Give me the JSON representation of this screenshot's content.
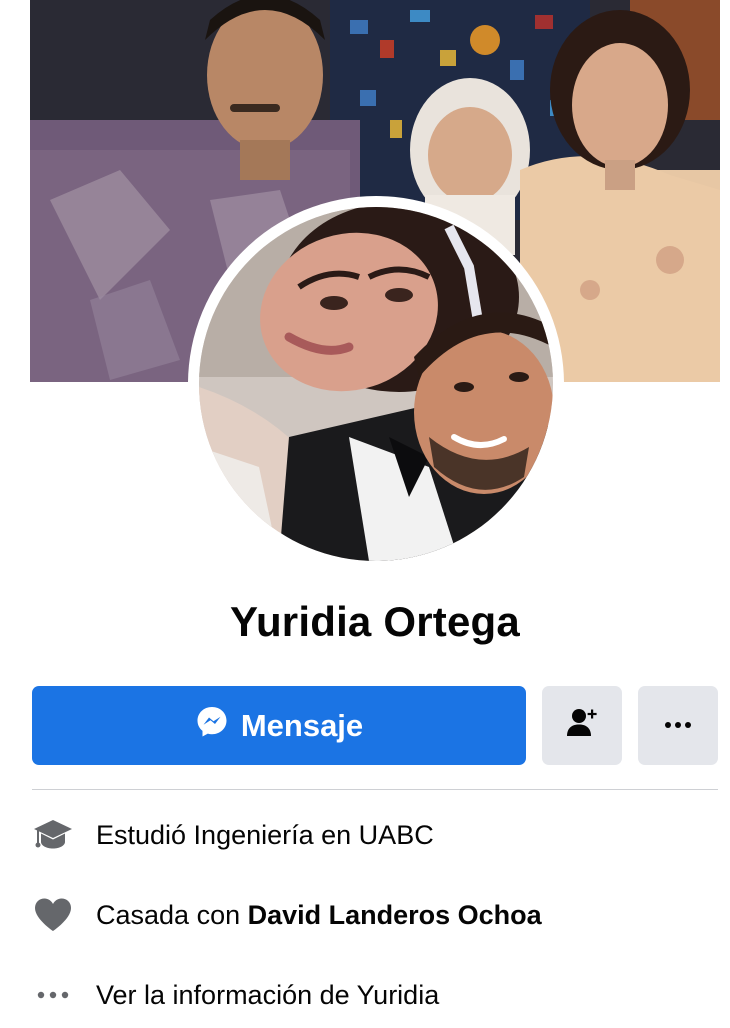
{
  "profile": {
    "name": "Yuridia Ortega"
  },
  "actions": {
    "message_label": "Mensaje",
    "add_friend_icon": "add-friend-icon",
    "more_icon": "more-icon"
  },
  "intro": {
    "education": "Estudió Ingeniería en UABC",
    "relationship_prefix": "Casada con ",
    "relationship_partner": "David Landeros Ochoa",
    "see_more": "Ver la información de Yuridia"
  },
  "colors": {
    "primary": "#1b74e4",
    "secondary_button": "#e4e6eb",
    "icon_gray": "#65676b",
    "text": "#050505",
    "divider": "#ced0d4"
  }
}
